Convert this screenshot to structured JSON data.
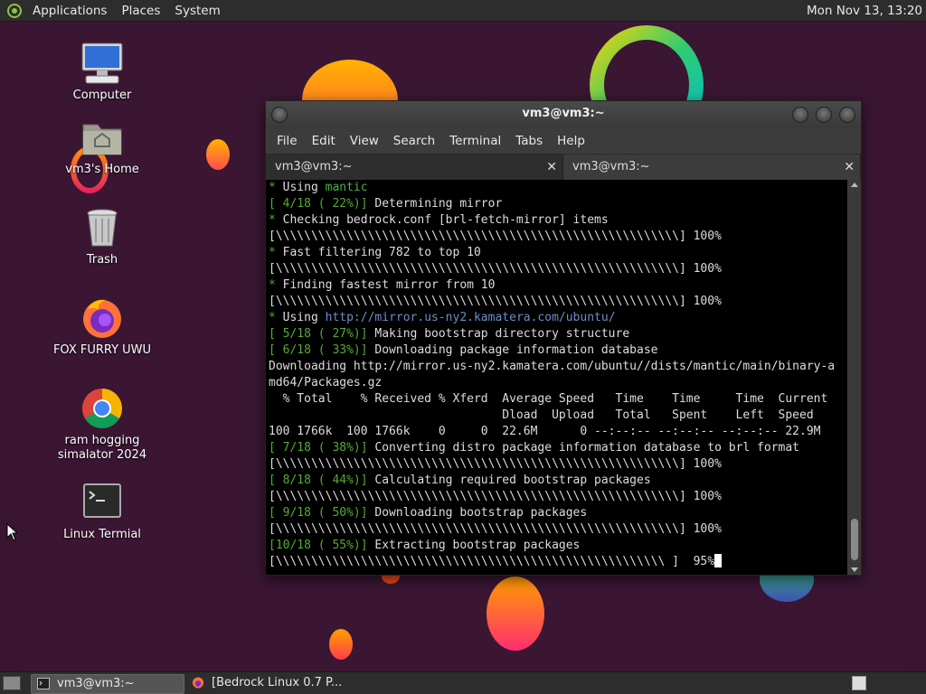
{
  "top_panel": {
    "menus": [
      "Applications",
      "Places",
      "System"
    ],
    "clock": "Mon Nov 13, 13:20"
  },
  "desktop_icons": [
    {
      "label": "Computer",
      "icon": "computer-icon"
    },
    {
      "label": "vm3's Home",
      "icon": "home-folder-icon"
    },
    {
      "label": "Trash",
      "icon": "trash-icon"
    },
    {
      "label": "FOX FURRY UWU",
      "icon": "firefox-icon"
    },
    {
      "label": "ram hogging simalator 2024",
      "icon": "chrome-icon"
    },
    {
      "label": "Linux Termial",
      "icon": "terminal-icon"
    }
  ],
  "window": {
    "title": "vm3@vm3:~",
    "menus": [
      "File",
      "Edit",
      "View",
      "Search",
      "Terminal",
      "Tabs",
      "Help"
    ],
    "tabs": [
      "vm3@vm3:~",
      "vm3@vm3:~"
    ]
  },
  "terminal_lines": [
    [
      {
        "t": "* ",
        "c": "g"
      },
      {
        "t": "Using "
      },
      {
        "t": "mantic",
        "c": "lg"
      }
    ],
    [
      {
        "t": "[ 4/18 ( 22%)] ",
        "c": "g"
      },
      {
        "t": "Determining mirror"
      }
    ],
    [
      {
        "t": "* ",
        "c": "g"
      },
      {
        "t": "Checking bedrock.conf [brl-fetch-mirror] items"
      }
    ],
    [
      {
        "t": "[\\\\\\\\\\\\\\\\\\\\\\\\\\\\\\\\\\\\\\\\\\\\\\\\\\\\\\\\\\\\\\\\\\\\\\\\\\\\\\\\\\\\\\\\\\\\\\\\\\\\\\\\\\\\\\\\\\] 100%"
      }
    ],
    [
      {
        "t": "* ",
        "c": "g"
      },
      {
        "t": "Fast filtering 782 to top 10"
      }
    ],
    [
      {
        "t": "[\\\\\\\\\\\\\\\\\\\\\\\\\\\\\\\\\\\\\\\\\\\\\\\\\\\\\\\\\\\\\\\\\\\\\\\\\\\\\\\\\\\\\\\\\\\\\\\\\\\\\\\\\\\\\\\\\\] 100%"
      }
    ],
    [
      {
        "t": "* ",
        "c": "g"
      },
      {
        "t": "Finding fastest mirror from 10"
      }
    ],
    [
      {
        "t": "[\\\\\\\\\\\\\\\\\\\\\\\\\\\\\\\\\\\\\\\\\\\\\\\\\\\\\\\\\\\\\\\\\\\\\\\\\\\\\\\\\\\\\\\\\\\\\\\\\\\\\\\\\\\\\\\\\\] 100%"
      }
    ],
    [
      {
        "t": "* ",
        "c": "g"
      },
      {
        "t": "Using "
      },
      {
        "t": "http://mirror.us-ny2.kamatera.com/ubuntu/",
        "c": "url"
      }
    ],
    [
      {
        "t": "[ 5/18 ( 27%)] ",
        "c": "g"
      },
      {
        "t": "Making bootstrap directory structure"
      }
    ],
    [
      {
        "t": "[ 6/18 ( 33%)] ",
        "c": "g"
      },
      {
        "t": "Downloading package information database"
      }
    ],
    [
      {
        "t": "Downloading http://mirror.us-ny2.kamatera.com/ubuntu//dists/mantic/main/binary-a"
      }
    ],
    [
      {
        "t": "md64/Packages.gz"
      }
    ],
    [
      {
        "t": "  % Total    % Received % Xferd  Average Speed   Time    Time     Time  Current"
      }
    ],
    [
      {
        "t": "                                 Dload  Upload   Total   Spent    Left  Speed"
      }
    ],
    [
      {
        "t": "100 1766k  100 1766k    0     0  22.6M      0 --:--:-- --:--:-- --:--:-- 22.9M"
      }
    ],
    [
      {
        "t": "[ 7/18 ( 38%)] ",
        "c": "g"
      },
      {
        "t": "Converting distro package information database to brl format"
      }
    ],
    [
      {
        "t": "[\\\\\\\\\\\\\\\\\\\\\\\\\\\\\\\\\\\\\\\\\\\\\\\\\\\\\\\\\\\\\\\\\\\\\\\\\\\\\\\\\\\\\\\\\\\\\\\\\\\\\\\\\\\\\\\\\\] 100%"
      }
    ],
    [
      {
        "t": "[ 8/18 ( 44%)] ",
        "c": "g"
      },
      {
        "t": "Calculating required bootstrap packages"
      }
    ],
    [
      {
        "t": "[\\\\\\\\\\\\\\\\\\\\\\\\\\\\\\\\\\\\\\\\\\\\\\\\\\\\\\\\\\\\\\\\\\\\\\\\\\\\\\\\\\\\\\\\\\\\\\\\\\\\\\\\\\\\\\\\\\] 100%"
      }
    ],
    [
      {
        "t": "[ 9/18 ( 50%)] ",
        "c": "g"
      },
      {
        "t": "Downloading bootstrap packages"
      }
    ],
    [
      {
        "t": "[\\\\\\\\\\\\\\\\\\\\\\\\\\\\\\\\\\\\\\\\\\\\\\\\\\\\\\\\\\\\\\\\\\\\\\\\\\\\\\\\\\\\\\\\\\\\\\\\\\\\\\\\\\\\\\\\\\] 100%"
      }
    ],
    [
      {
        "t": "[10/18 ( 55%)] ",
        "c": "g"
      },
      {
        "t": "Extracting bootstrap packages"
      }
    ],
    [
      {
        "t": "[\\\\\\\\\\\\\\\\\\\\\\\\\\\\\\\\\\\\\\\\\\\\\\\\\\\\\\\\\\\\\\\\\\\\\\\\\\\\\\\\\\\\\\\\\\\\\\\\\\\\\\\\\\\\\\ ]  95%"
      }
    ]
  ],
  "taskbar": {
    "tasks": [
      "vm3@vm3:~",
      "[Bedrock Linux 0.7 P..."
    ]
  },
  "colors": {
    "prompt_green": "#55aa33",
    "url_blue": "#6a8fc8",
    "desktop_bg": "#3a1633"
  }
}
